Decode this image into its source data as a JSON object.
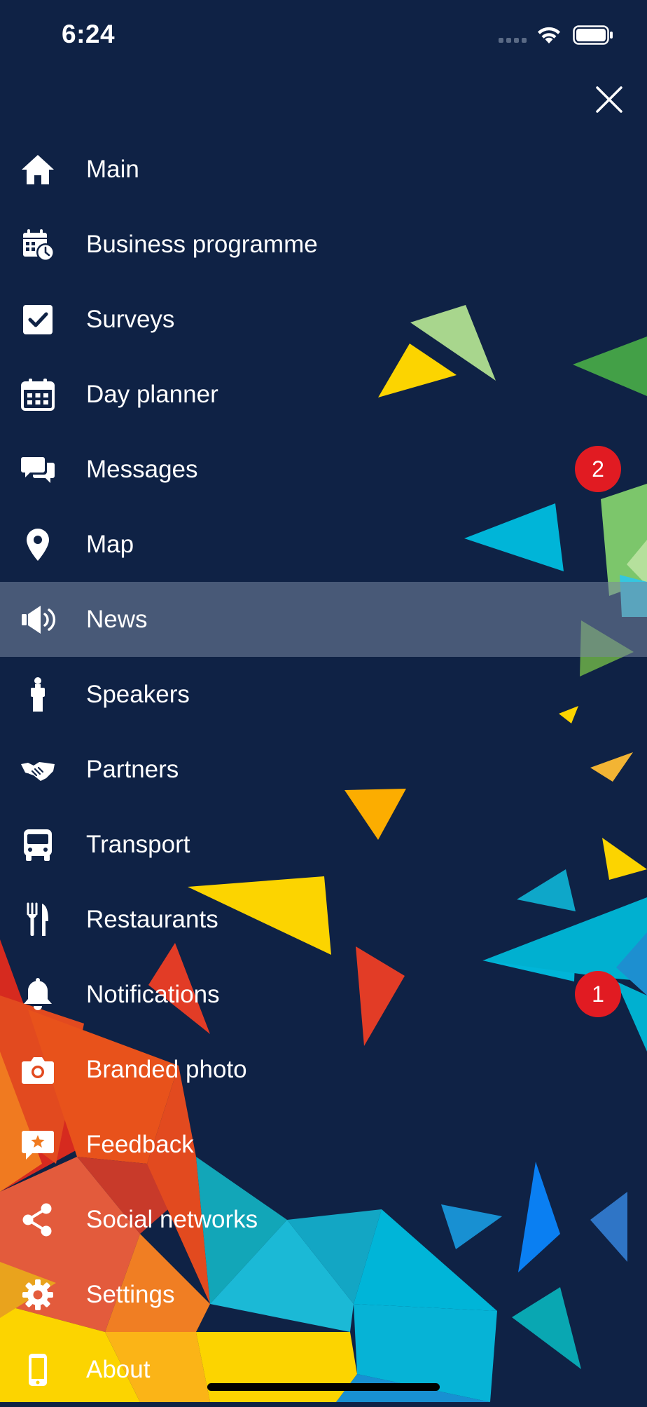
{
  "status_bar": {
    "time": "6:24",
    "signal_icon": "signal-dots-icon",
    "wifi_icon": "wifi-icon",
    "battery_icon": "battery-icon"
  },
  "close_icon": "close-icon",
  "colors": {
    "background": "#0f2245",
    "active_row": "#475873",
    "badge": "#e11b22",
    "text": "#ffffff"
  },
  "menu": {
    "active_index": 6,
    "items": [
      {
        "label": "Main",
        "icon": "home-icon"
      },
      {
        "label": "Business programme",
        "icon": "calendar-clock-icon"
      },
      {
        "label": "Surveys",
        "icon": "checkbox-icon"
      },
      {
        "label": "Day planner",
        "icon": "calendar-grid-icon"
      },
      {
        "label": "Messages",
        "icon": "chat-bubbles-icon",
        "badge": "2"
      },
      {
        "label": "Map",
        "icon": "map-pin-icon"
      },
      {
        "label": "News",
        "icon": "megaphone-icon"
      },
      {
        "label": "Speakers",
        "icon": "speaker-person-icon"
      },
      {
        "label": "Partners",
        "icon": "handshake-icon"
      },
      {
        "label": "Transport",
        "icon": "bus-icon"
      },
      {
        "label": "Restaurants",
        "icon": "fork-knife-icon"
      },
      {
        "label": "Notifications",
        "icon": "bell-icon",
        "badge": "1"
      },
      {
        "label": "Branded photo",
        "icon": "camera-icon"
      },
      {
        "label": "Feedback",
        "icon": "feedback-star-icon"
      },
      {
        "label": "Social networks",
        "icon": "share-icon"
      },
      {
        "label": "Settings",
        "icon": "gear-icon"
      },
      {
        "label": "About",
        "icon": "phone-icon"
      }
    ]
  }
}
